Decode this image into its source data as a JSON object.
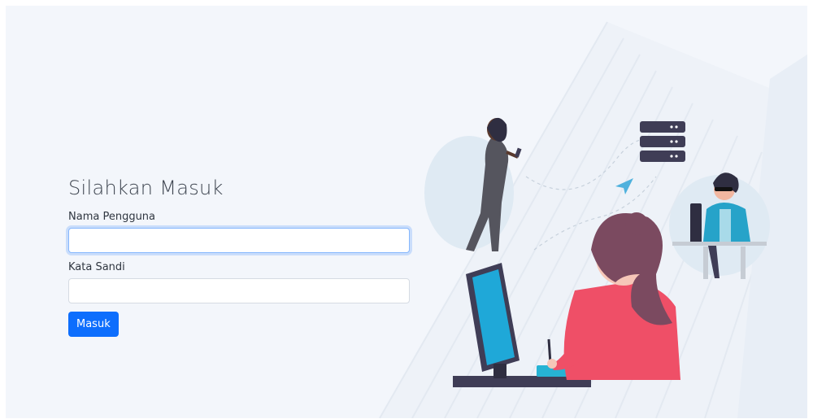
{
  "login": {
    "title": "Silahkan Masuk",
    "username_label": "Nama Pengguna",
    "username_value": "",
    "password_label": "Kata Sandi",
    "password_value": "",
    "submit_label": "Masuk"
  },
  "colors": {
    "primary": "#0d6efd",
    "background": "#f3f6fb",
    "accent_pink": "#ef4f67",
    "accent_blue": "#1fa8d8",
    "dark_navy": "#3f3d56"
  }
}
